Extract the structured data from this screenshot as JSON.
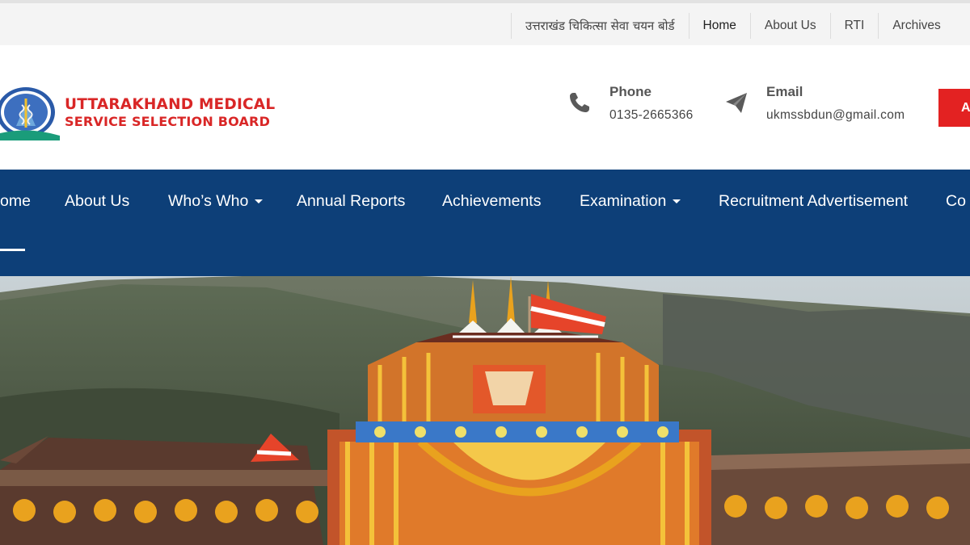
{
  "topbar": {
    "links": [
      {
        "label": "उत्तराखंड चिकित्सा सेवा चयन बोर्ड",
        "active": false
      },
      {
        "label": "Home",
        "active": true
      },
      {
        "label": "About Us",
        "active": false
      },
      {
        "label": "RTI",
        "active": false
      },
      {
        "label": "Archives",
        "active": false
      }
    ]
  },
  "header": {
    "logo_line1": "UTTARAKHAND MEDICAL",
    "logo_line2": "SERVICE SELECTION BOARD",
    "phone": {
      "label": "Phone",
      "value": "0135-2665366",
      "icon": "phone-icon"
    },
    "email": {
      "label": "Email",
      "value": "ukmssbdun@gmail.com",
      "icon": "paper-plane-icon"
    },
    "apply_label": "A"
  },
  "nav": {
    "items": [
      {
        "label": "ome",
        "has_dropdown": false,
        "active": true
      },
      {
        "label": "About Us",
        "has_dropdown": false
      },
      {
        "label": "Who’s Who",
        "has_dropdown": true
      },
      {
        "label": "Annual Reports",
        "has_dropdown": false
      },
      {
        "label": "Achievements",
        "has_dropdown": false
      },
      {
        "label": "Examination",
        "has_dropdown": true
      },
      {
        "label": "Recruitment Advertisement",
        "has_dropdown": false
      },
      {
        "label": "Co",
        "has_dropdown": false
      }
    ]
  },
  "colors": {
    "nav_bg": "#0d3f78",
    "brand_red": "#d92626",
    "apply_btn": "#e32222"
  }
}
